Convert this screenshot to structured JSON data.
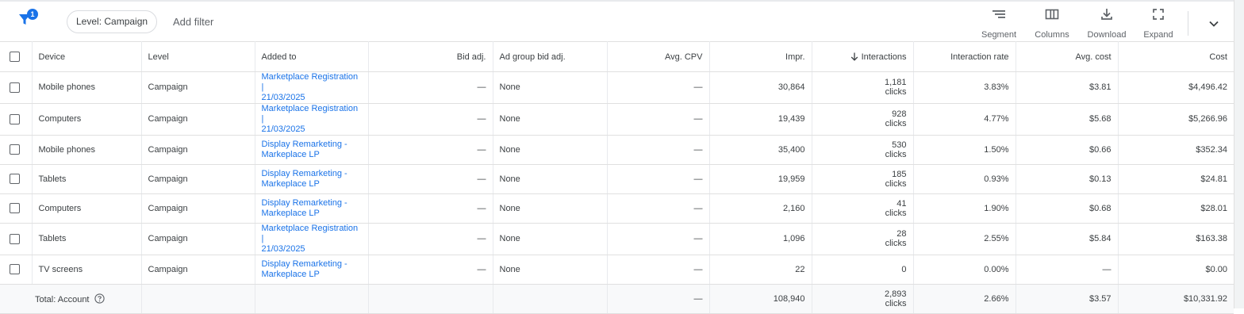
{
  "toolbar": {
    "filter_count": "1",
    "level_chip": "Level: Campaign",
    "add_filter": "Add filter",
    "segment": "Segment",
    "columns": "Columns",
    "download": "Download",
    "expand": "Expand"
  },
  "table": {
    "headers": {
      "device": "Device",
      "level": "Level",
      "added_to": "Added to",
      "bid_adj": "Bid adj.",
      "ad_group_bid_adj": "Ad group bid adj.",
      "avg_cpv": "Avg. CPV",
      "impr": "Impr.",
      "interactions": "Interactions",
      "interaction_rate": "Interaction rate",
      "avg_cost": "Avg. cost",
      "cost": "Cost"
    },
    "rows": [
      {
        "device": "Mobile phones",
        "level": "Campaign",
        "added_to_1": "Marketplace Registration |",
        "added_to_2": "21/03/2025",
        "bid_adj": "—",
        "ad_group_bid_adj": "None",
        "avg_cpv": "—",
        "impr": "30,864",
        "interactions": "1,181",
        "interactions_unit": "clicks",
        "interaction_rate": "3.83%",
        "avg_cost": "$3.81",
        "cost": "$4,496.42"
      },
      {
        "device": "Computers",
        "level": "Campaign",
        "added_to_1": "Marketplace Registration |",
        "added_to_2": "21/03/2025",
        "bid_adj": "—",
        "ad_group_bid_adj": "None",
        "avg_cpv": "—",
        "impr": "19,439",
        "interactions": "928",
        "interactions_unit": "clicks",
        "interaction_rate": "4.77%",
        "avg_cost": "$5.68",
        "cost": "$5,266.96"
      },
      {
        "device": "Mobile phones",
        "level": "Campaign",
        "added_to_1": "Display Remarketing -",
        "added_to_2": "Markeplace LP",
        "bid_adj": "—",
        "ad_group_bid_adj": "None",
        "avg_cpv": "—",
        "impr": "35,400",
        "interactions": "530",
        "interactions_unit": "clicks",
        "interaction_rate": "1.50%",
        "avg_cost": "$0.66",
        "cost": "$352.34"
      },
      {
        "device": "Tablets",
        "level": "Campaign",
        "added_to_1": "Display Remarketing -",
        "added_to_2": "Markeplace LP",
        "bid_adj": "—",
        "ad_group_bid_adj": "None",
        "avg_cpv": "—",
        "impr": "19,959",
        "interactions": "185",
        "interactions_unit": "clicks",
        "interaction_rate": "0.93%",
        "avg_cost": "$0.13",
        "cost": "$24.81"
      },
      {
        "device": "Computers",
        "level": "Campaign",
        "added_to_1": "Display Remarketing -",
        "added_to_2": "Markeplace LP",
        "bid_adj": "—",
        "ad_group_bid_adj": "None",
        "avg_cpv": "—",
        "impr": "2,160",
        "interactions": "41",
        "interactions_unit": "clicks",
        "interaction_rate": "1.90%",
        "avg_cost": "$0.68",
        "cost": "$28.01"
      },
      {
        "device": "Tablets",
        "level": "Campaign",
        "added_to_1": "Marketplace Registration |",
        "added_to_2": "21/03/2025",
        "bid_adj": "—",
        "ad_group_bid_adj": "None",
        "avg_cpv": "—",
        "impr": "1,096",
        "interactions": "28",
        "interactions_unit": "clicks",
        "interaction_rate": "2.55%",
        "avg_cost": "$5.84",
        "cost": "$163.38"
      },
      {
        "device": "TV screens",
        "level": "Campaign",
        "added_to_1": "Display Remarketing -",
        "added_to_2": "Markeplace LP",
        "bid_adj": "—",
        "ad_group_bid_adj": "None",
        "avg_cpv": "—",
        "impr": "22",
        "interactions": "0",
        "interactions_unit": "",
        "interaction_rate": "0.00%",
        "avg_cost": "—",
        "cost": "$0.00"
      }
    ],
    "total": {
      "label": "Total: Account",
      "avg_cpv": "—",
      "impr": "108,940",
      "interactions": "2,893",
      "interactions_unit": "clicks",
      "interaction_rate": "2.66%",
      "avg_cost": "$3.57",
      "cost": "$10,331.92"
    }
  },
  "icons": {
    "filter": "filter-icon",
    "segment": "segment-icon",
    "columns": "columns-icon",
    "download": "download-icon",
    "expand": "expand-icon",
    "more": "chevron-down-icon",
    "sort": "arrow-down-icon",
    "help": "help-icon"
  },
  "colors": {
    "accent": "#1a73e8",
    "text": "#3c4043",
    "border": "#e0e0e0"
  }
}
